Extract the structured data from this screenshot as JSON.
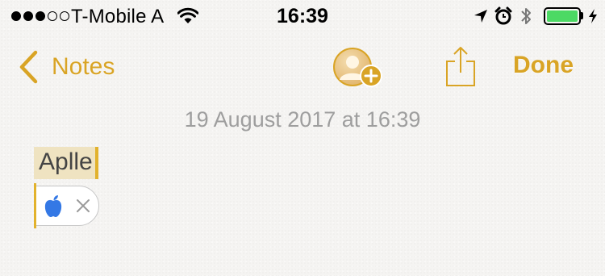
{
  "status_bar": {
    "signal_bars": [
      true,
      true,
      true,
      false,
      false
    ],
    "carrier": "T-Mobile A",
    "time": "16:39",
    "icons": [
      "wifi-icon",
      "location-icon",
      "alarm-icon",
      "bluetooth-icon",
      "battery-icon",
      "charging-icon"
    ],
    "battery_level": 1.0
  },
  "nav": {
    "back_label": "Notes",
    "add_people_icon": "add-people-icon",
    "share_icon": "share-icon",
    "done_label": "Done"
  },
  "note": {
    "date": "19 August 2017 at 16:39",
    "text": "Aplle"
  },
  "suggestion": {
    "icon": "apple-icon",
    "dismiss_icon": "close-icon"
  },
  "colors": {
    "accent": "#d9a425",
    "cursor": "#e2b22c",
    "selection": "#efe3c1",
    "battery": "#4cd964",
    "date_text": "#9e9e9e",
    "apple_blue": "#3478e5"
  }
}
